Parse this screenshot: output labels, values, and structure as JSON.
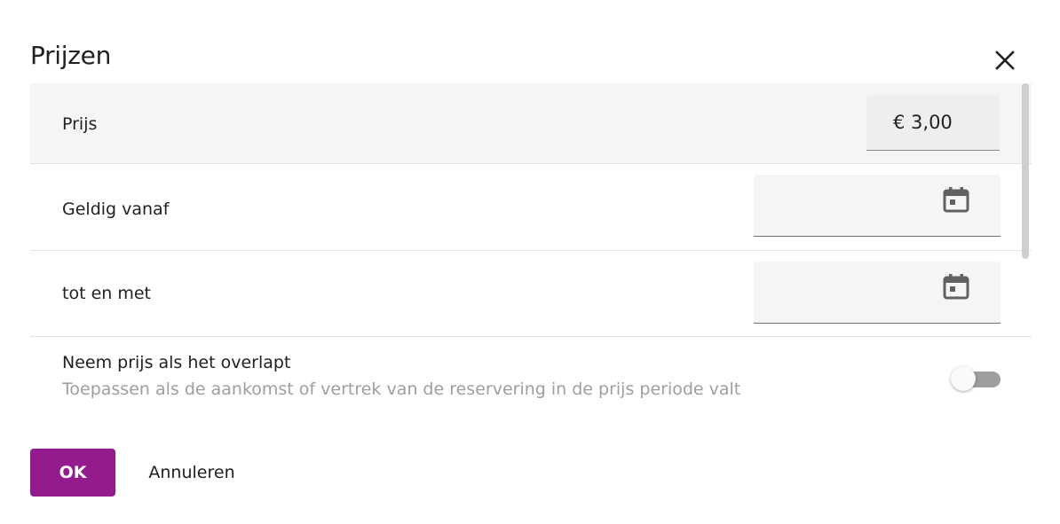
{
  "dialog": {
    "title": "Prijzen",
    "close_icon": "close-icon"
  },
  "fields": {
    "price": {
      "label": "Prijs",
      "value": "€ 3,00"
    },
    "valid_from": {
      "label": "Geldig vanaf",
      "value": "",
      "icon": "calendar-icon"
    },
    "valid_until": {
      "label": "tot en met",
      "value": "",
      "icon": "calendar-icon"
    },
    "overlap": {
      "label": "Neem prijs als het overlapt",
      "description": "Toepassen als de aankomst of vertrek van de reservering in de prijs periode valt",
      "enabled": false
    }
  },
  "actions": {
    "ok_label": "OK",
    "cancel_label": "Annuleren"
  },
  "colors": {
    "primary": "#931b8d",
    "field_background": "#f5f5f5",
    "secondary_text": "#9e9e9e"
  }
}
